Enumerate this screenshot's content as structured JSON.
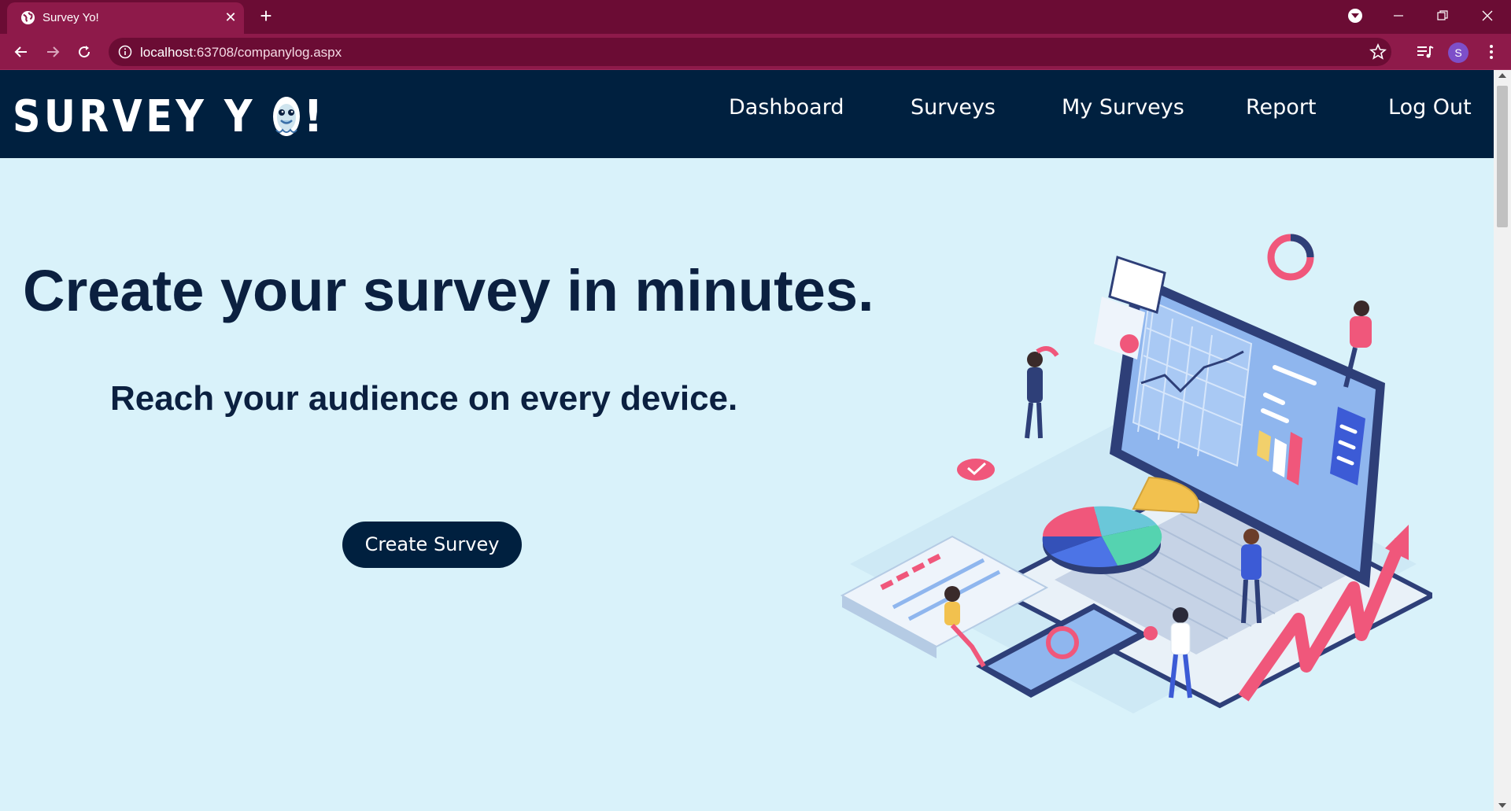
{
  "browser": {
    "tab_title": "Survey Yo!",
    "url_host": "localhost",
    "url_rest": ":63708/companylog.aspx",
    "profile_initial": "S",
    "icons": [
      "globe-icon",
      "close-icon",
      "plus-icon",
      "back-icon",
      "forward-icon",
      "reload-icon",
      "info-icon",
      "star-icon",
      "media-icon",
      "menu-icon",
      "minimize-icon",
      "restore-icon"
    ]
  },
  "colors": {
    "chrome_dark": "#6b0c34",
    "chrome_light": "#8e1a4a",
    "header_bg": "#00203f",
    "page_bg": "#d9f2fa",
    "heading": "#0b2040"
  },
  "header": {
    "logo_text": "SURVEY Y",
    "logo_end": "!",
    "nav": [
      "Dashboard",
      "Surveys",
      "My Surveys",
      "Report",
      "Log Out"
    ]
  },
  "hero": {
    "title": "Create your survey in minutes.",
    "subtitle": "Reach your audience on every device.",
    "cta": "Create Survey"
  }
}
